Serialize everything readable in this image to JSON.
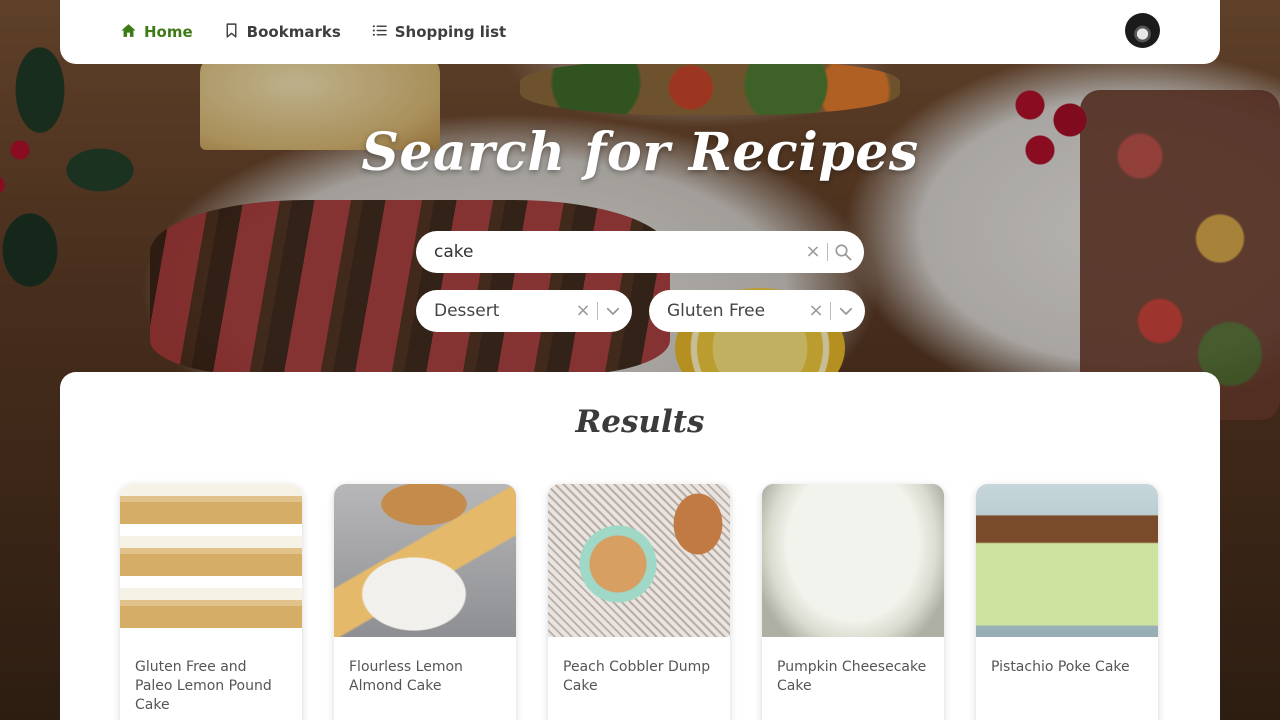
{
  "nav": {
    "items": [
      {
        "label": "Home",
        "icon": "home-icon",
        "active": true
      },
      {
        "label": "Bookmarks",
        "icon": "bookmark-icon",
        "active": false
      },
      {
        "label": "Shopping list",
        "icon": "list-icon",
        "active": false
      }
    ],
    "active_color": "#3e7a16"
  },
  "hero": {
    "title": "Search for Recipes"
  },
  "search": {
    "value": "cake"
  },
  "filters": {
    "diet": {
      "value": "Dessert"
    },
    "health": {
      "value": "Gluten Free"
    }
  },
  "results": {
    "title": "Results",
    "cards": [
      {
        "title": "Gluten Free and Paleo Lemon Pound Cake"
      },
      {
        "title": "Flourless Lemon Almond Cake"
      },
      {
        "title": "Peach Cobbler Dump Cake"
      },
      {
        "title": "Pumpkin Cheesecake Cake"
      },
      {
        "title": "Pistachio Poke Cake"
      }
    ]
  }
}
